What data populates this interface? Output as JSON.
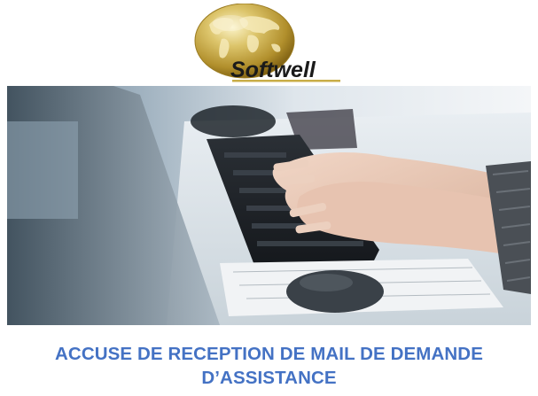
{
  "logo": {
    "brand_text": "Softwell",
    "icon": "globe-logo-icon",
    "colors": {
      "gold_light": "#f2e6a6",
      "gold_mid": "#c9ad47",
      "gold_dark": "#8a6d17",
      "text": "#1a1a1a"
    }
  },
  "hero": {
    "icon": "hands-typing-on-keyboard-photo"
  },
  "title": {
    "line1": "ACCUSE DE RECEPTION DE MAIL DE DEMANDE",
    "line2": "D’ASSISTANCE",
    "color": "#4472c4"
  }
}
